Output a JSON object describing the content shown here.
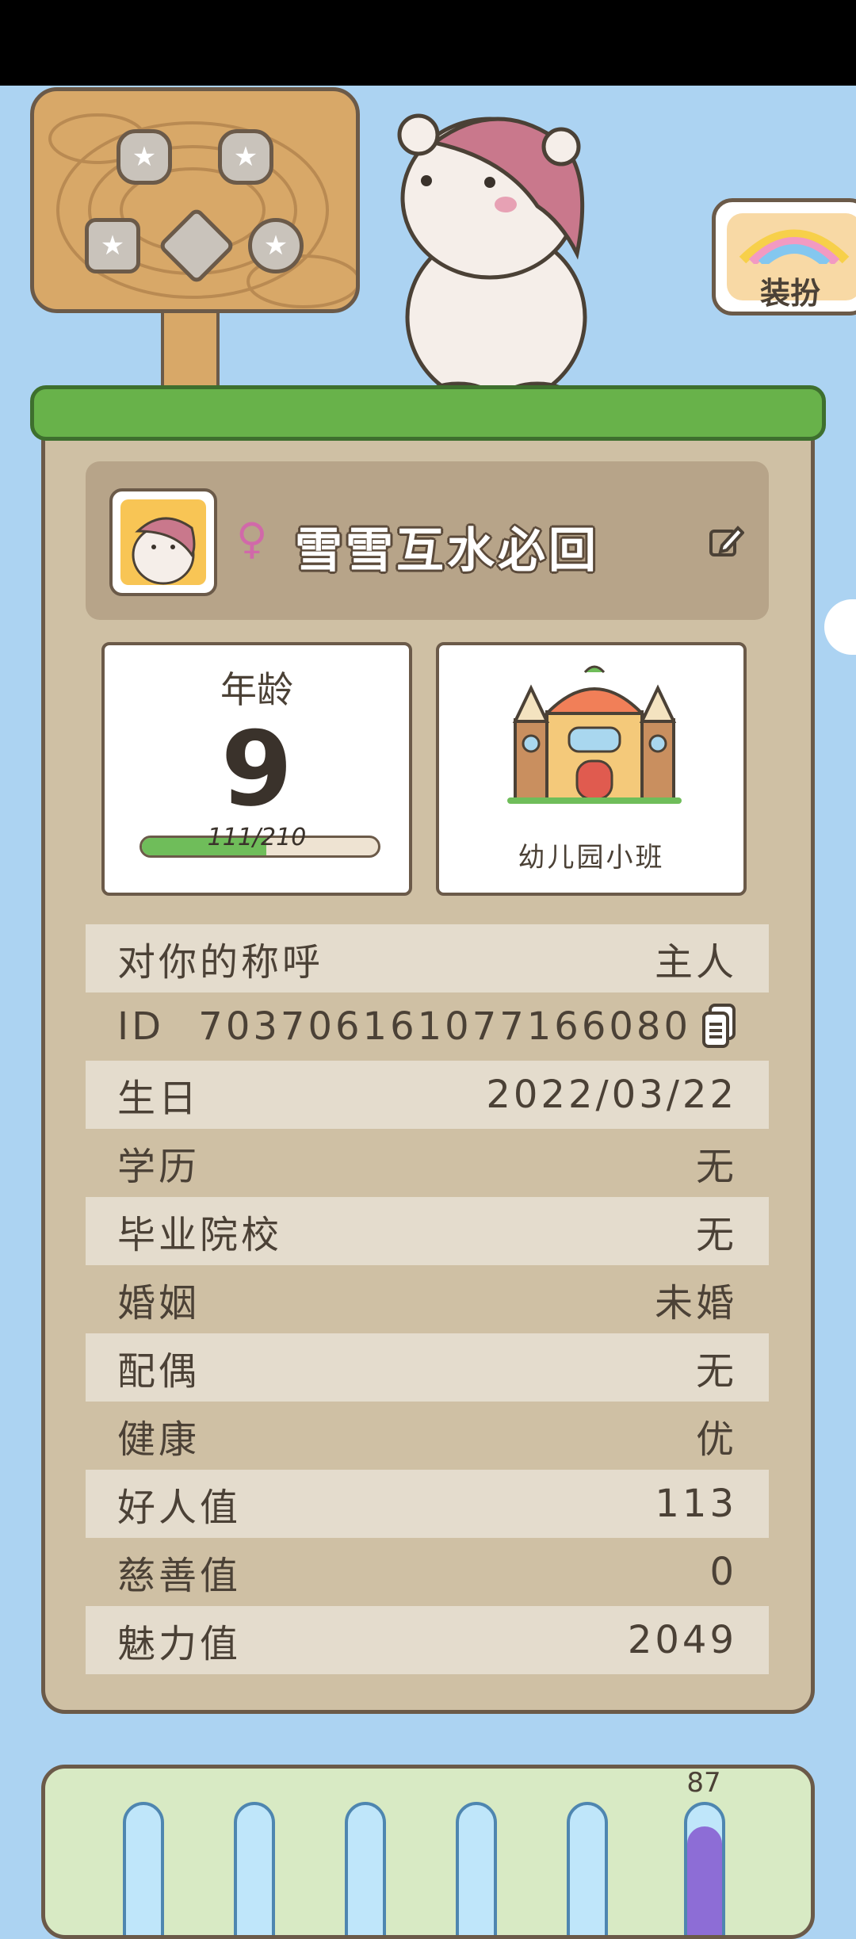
{
  "dressup": {
    "label": "装扮"
  },
  "profile": {
    "gender_symbol": "♀",
    "nickname": "雪雪互水必回"
  },
  "age_card": {
    "label": "年龄",
    "value": "9",
    "progress_text": "111/210",
    "progress_fraction": 0.528
  },
  "school_card": {
    "name": "幼儿园小班"
  },
  "details": [
    {
      "label": "对你的称呼",
      "value": "主人"
    },
    {
      "label": "ID",
      "value": "703706161077166080"
    },
    {
      "label": "生日",
      "value": "2022/03/22"
    },
    {
      "label": "学历",
      "value": "无"
    },
    {
      "label": "毕业院校",
      "value": "无"
    },
    {
      "label": "婚姻",
      "value": "未婚"
    },
    {
      "label": "配偶",
      "value": "无"
    },
    {
      "label": "健康",
      "value": "优"
    },
    {
      "label": "好人值",
      "value": "113"
    },
    {
      "label": "慈善值",
      "value": "0"
    },
    {
      "label": "魅力值",
      "value": "2049"
    }
  ],
  "stat_tubes": {
    "visible_value": "87"
  },
  "colors": {
    "sky": "#acd3f2",
    "panel": "#cfc0a4",
    "grass": "#68b24a",
    "tube_fill": "#8d6dd6"
  }
}
